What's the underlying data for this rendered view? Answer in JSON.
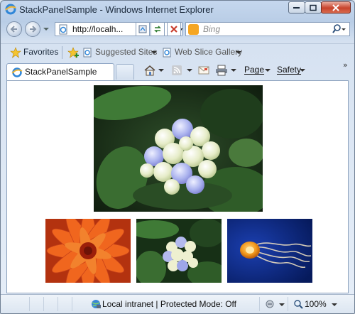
{
  "window": {
    "title": "StackPanelSample - Windows Internet Explorer"
  },
  "address_bar": {
    "url": "http://localh..."
  },
  "search": {
    "placeholder": "Bing"
  },
  "favorites_bar": {
    "favorites_label": "Favorites",
    "suggested_sites_label": "Suggested Sites",
    "web_slice_gallery_label": "Web Slice Gallery"
  },
  "tabs": [
    {
      "label": "StackPanelSample",
      "active": true
    }
  ],
  "command_bar": {
    "page_label": "Page",
    "safety_label": "Safety"
  },
  "content": {
    "images": [
      {
        "subject": "blue and white hydrangea flower with green leaves",
        "role": "main"
      },
      {
        "subject": "orange dahlia flower",
        "role": "thumbnail"
      },
      {
        "subject": "blue and white hydrangea flower",
        "role": "thumbnail"
      },
      {
        "subject": "orange jellyfish on deep blue water",
        "role": "thumbnail"
      }
    ]
  },
  "status_bar": {
    "zone_text": "Local intranet | Protected Mode: Off",
    "zoom_text": "100%"
  },
  "icons": {
    "browser": "ie-logo-icon",
    "back": "back-arrow-icon",
    "forward": "forward-arrow-icon",
    "home": "home-icon",
    "feeds": "rss-feed-icon",
    "mail": "mail-icon",
    "print": "printer-icon",
    "search": "magnifier-icon"
  },
  "colors": {
    "chrome": "#c5d7ee",
    "close_button": "#c8432c",
    "content_bg": "#ffffff"
  }
}
